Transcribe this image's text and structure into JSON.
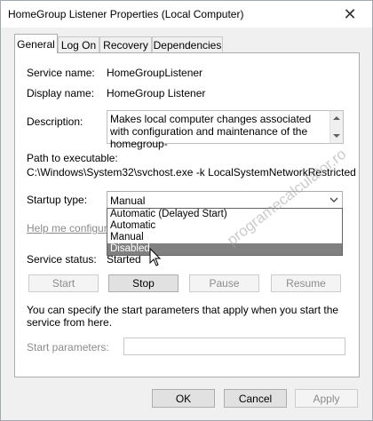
{
  "window": {
    "title": "HomeGroup Listener Properties (Local Computer)"
  },
  "tabs": [
    {
      "label": "General",
      "active": true
    },
    {
      "label": "Log On"
    },
    {
      "label": "Recovery"
    },
    {
      "label": "Dependencies"
    }
  ],
  "general": {
    "service_name_label": "Service name:",
    "service_name": "HomeGroupListener",
    "display_name_label": "Display name:",
    "display_name": "HomeGroup Listener",
    "description_label": "Description:",
    "description": "Makes local computer changes associated with configuration and maintenance of the homegroup-",
    "path_label": "Path to executable:",
    "path": "C:\\Windows\\System32\\svchost.exe -k LocalSystemNetworkRestricted",
    "startup_label": "Startup type:",
    "startup_value": "Manual",
    "startup_options": [
      "Automatic (Delayed Start)",
      "Automatic",
      "Manual",
      "Disabled"
    ],
    "startup_highlighted": "Disabled",
    "help_link": "Help me configure s",
    "status_label": "Service status:",
    "status_value": "Started",
    "buttons": {
      "start": "Start",
      "stop": "Stop",
      "pause": "Pause",
      "resume": "Resume"
    },
    "hint": "You can specify the start parameters that apply when you start the service from here.",
    "params_label": "Start parameters:"
  },
  "footer": {
    "ok": "OK",
    "cancel": "Cancel",
    "apply": "Apply"
  },
  "watermark": "programecalculator.ro",
  "colors": {
    "highlight": "#808080",
    "window_bg": "#f0f0f0",
    "panel_bg": "#ffffff"
  }
}
